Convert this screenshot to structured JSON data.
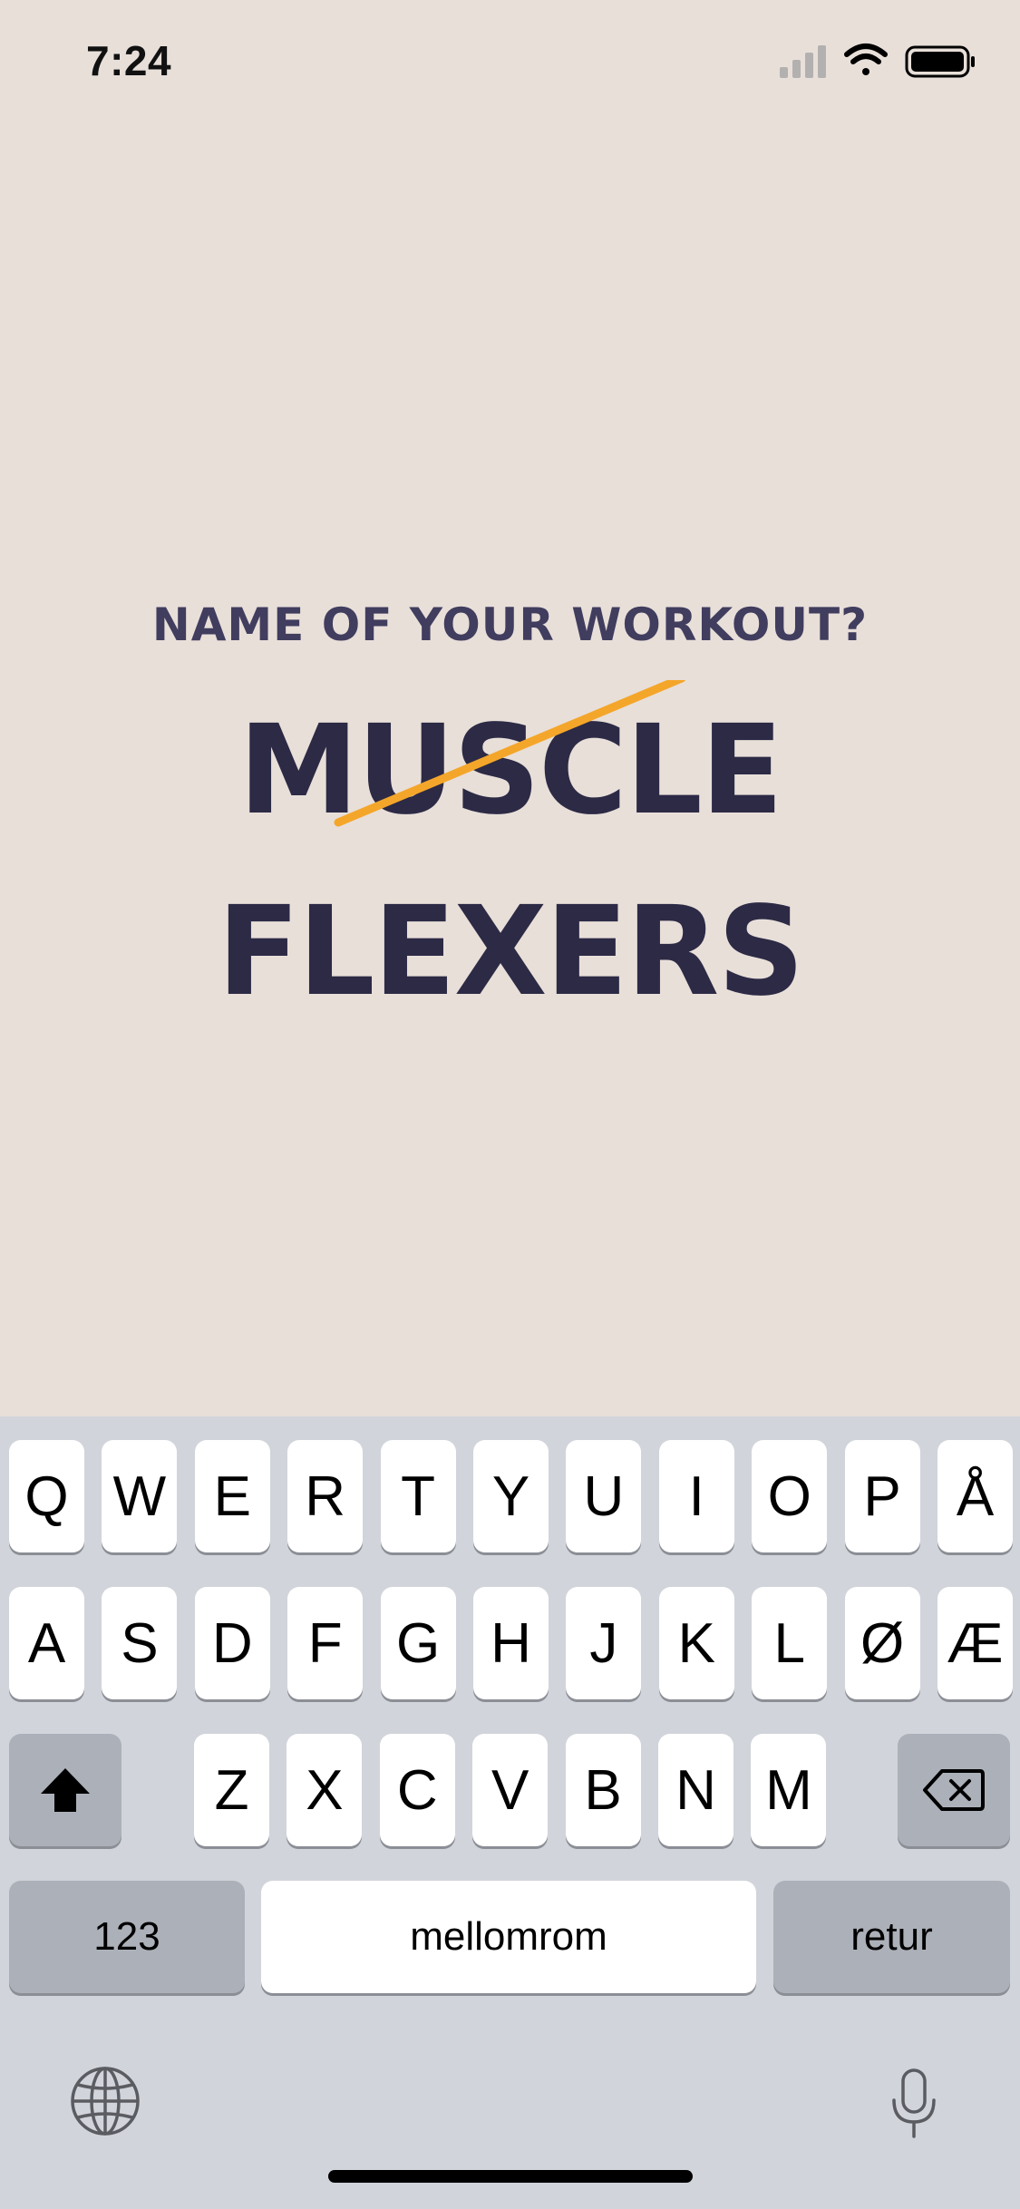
{
  "status_bar": {
    "time": "7:24",
    "signal_icon": "cellular-signal-icon",
    "wifi_icon": "wifi-icon",
    "battery_icon": "battery-icon"
  },
  "prompt": {
    "question": "NAME OF YOUR WORKOUT?",
    "answer": "MUSCLE FLEXERS",
    "accent_color": "#f4a62a"
  },
  "keyboard": {
    "row1": [
      "Q",
      "W",
      "E",
      "R",
      "T",
      "Y",
      "U",
      "I",
      "O",
      "P",
      "Å"
    ],
    "row2": [
      "A",
      "S",
      "D",
      "F",
      "G",
      "H",
      "J",
      "K",
      "L",
      "Ø",
      "Æ"
    ],
    "row3": [
      "Z",
      "X",
      "C",
      "V",
      "B",
      "N",
      "M"
    ],
    "shift_icon": "shift-arrow-icon",
    "delete_icon": "backspace-icon",
    "numbers_label": "123",
    "space_label": "mellomrom",
    "return_label": "retur",
    "globe_icon": "globe-icon",
    "mic_icon": "microphone-icon"
  }
}
